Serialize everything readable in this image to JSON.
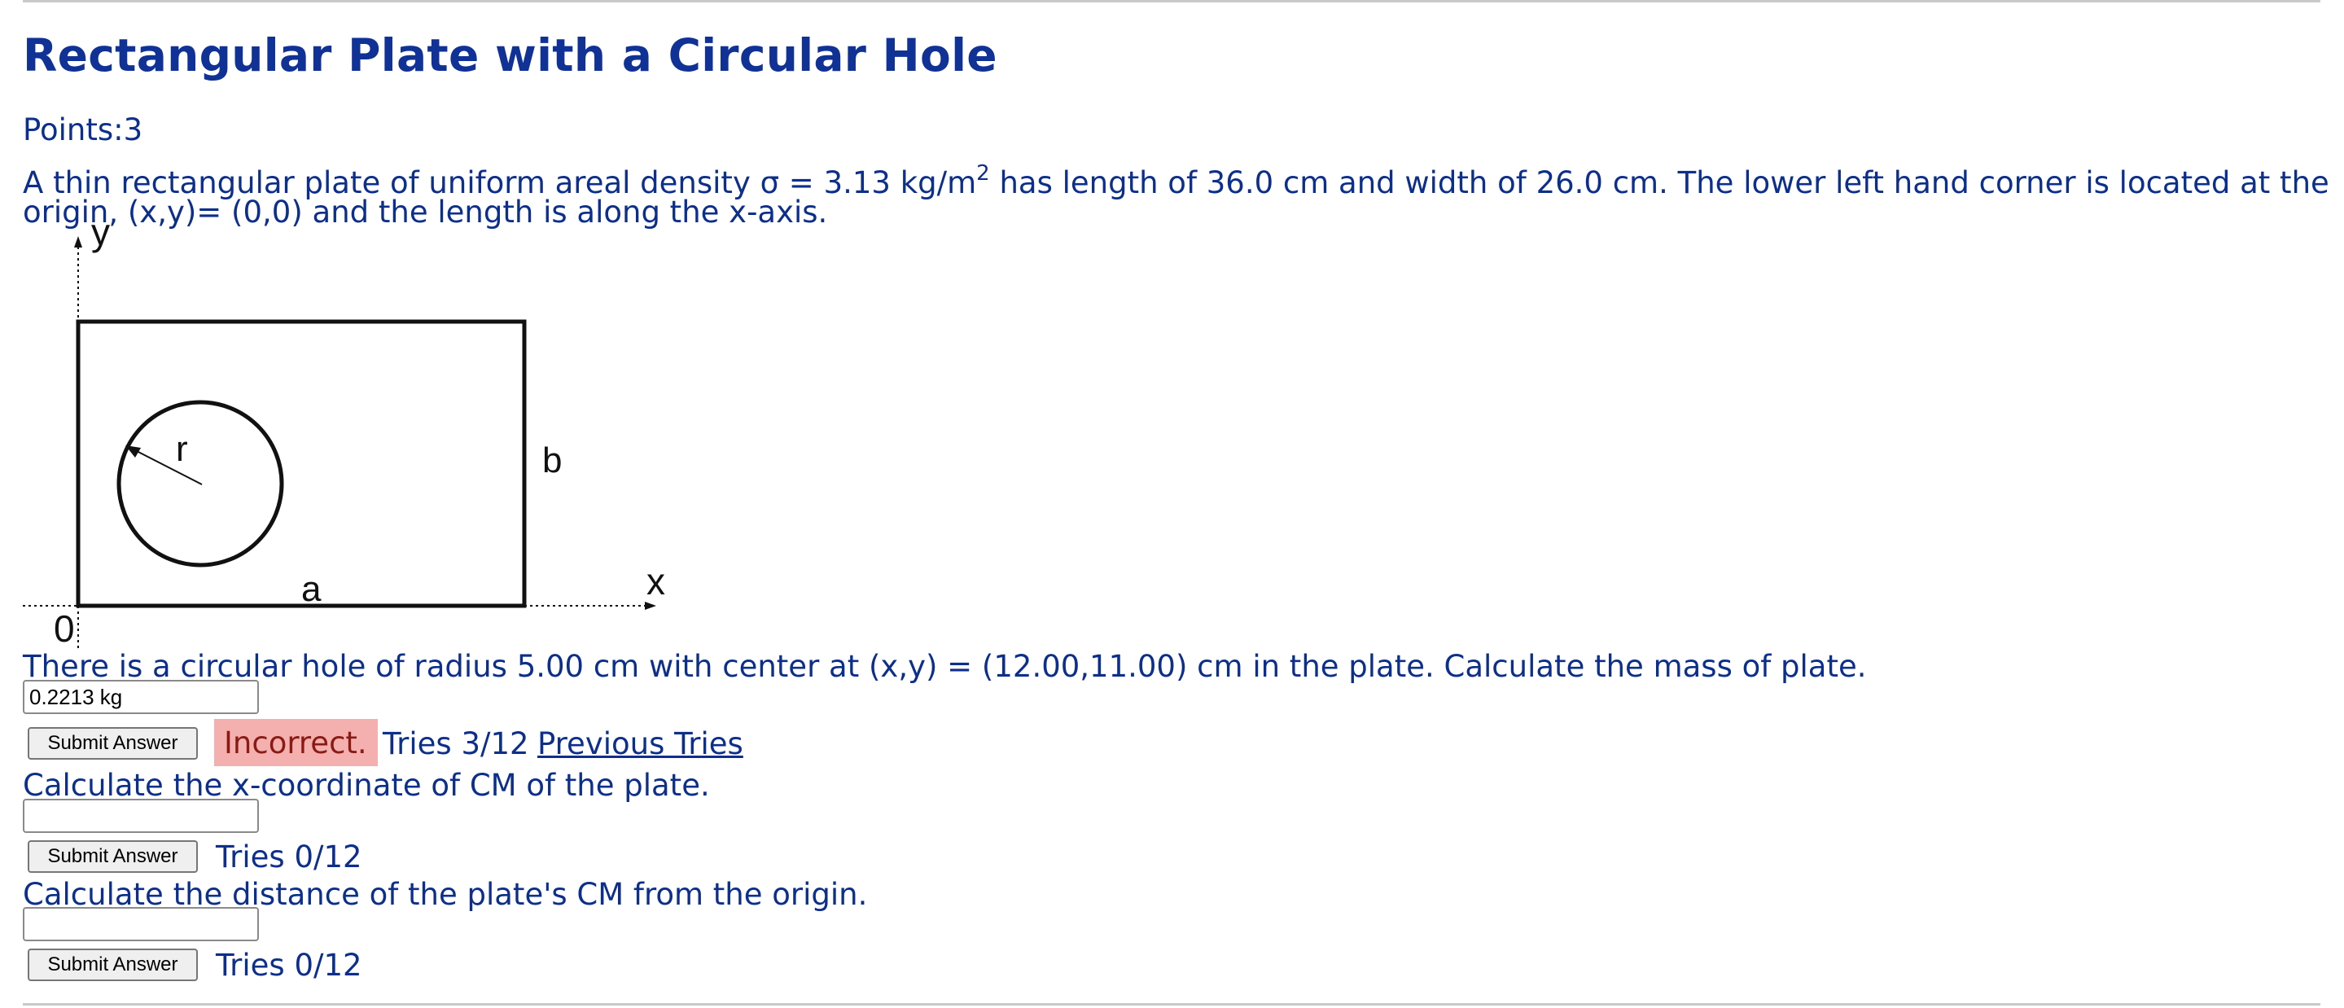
{
  "problem": {
    "title": "Rectangular Plate with a Circular Hole",
    "points": "Points:3",
    "intro_part1": "A thin rectangular plate of uniform areal density σ = 3.13 kg/m",
    "intro_sup": "2",
    "intro_part2": " has length of 36.0 cm and width of 26.0 cm. The lower left hand corner is located at the",
    "intro_line2": "origin, (x,y)= (0,0) and the length is along the x-axis."
  },
  "figure": {
    "axis_y": "y",
    "axis_x": "x",
    "origin": "0",
    "radius_label": "r",
    "height_label": "b",
    "length_label": "a"
  },
  "questions": [
    {
      "prompt": "There is a circular hole of radius 5.00 cm with center at (x,y) = (12.00,11.00) cm in the plate. Calculate the mass of plate.",
      "answer_value": "0.2213 kg",
      "submit_label": "Submit Answer",
      "status": "Incorrect.",
      "tries": "Tries 3/12",
      "previous_tries_link": "Previous Tries"
    },
    {
      "prompt": "Calculate the x-coordinate of CM of the plate.",
      "answer_value": "",
      "submit_label": "Submit Answer",
      "tries": "Tries 0/12"
    },
    {
      "prompt": "Calculate the distance of the plate's CM from the origin.",
      "answer_value": "",
      "submit_label": "Submit Answer",
      "tries": "Tries 0/12"
    }
  ],
  "colors": {
    "heading": "#103195",
    "text": "#0d2f8c",
    "incorrect_bg": "#f4b0ae",
    "incorrect_text": "#8a1a14",
    "rule": "#c9c9c9"
  }
}
